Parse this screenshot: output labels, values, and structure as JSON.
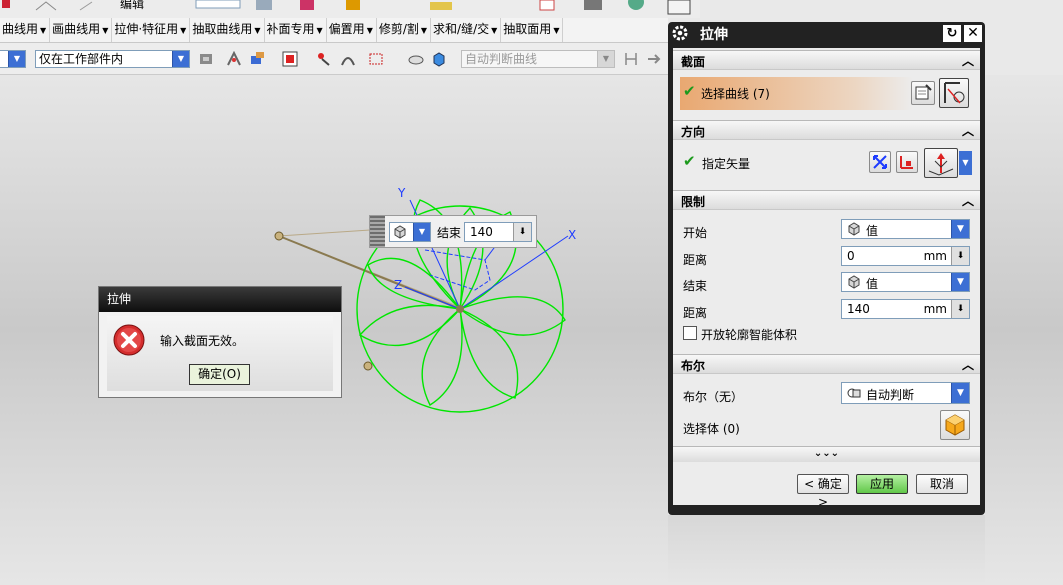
{
  "menubar": {
    "items": [
      "曲线用",
      "画曲线用",
      "拉伸·特征用",
      "抽取曲线用",
      "补面专用",
      "偏置用",
      "修剪/割",
      "求和/缝/交",
      "抽取面用"
    ]
  },
  "toolbar": {
    "edit_label": "编辑",
    "scope_filter": "仅在工作部件内",
    "curve_rule": "自动判断曲线"
  },
  "handle_widget": {
    "label": "结束",
    "value": "140"
  },
  "viewport": {
    "axis_x": "X",
    "axis_y": "Y",
    "axis_z": "Z",
    "curve_color": "#00e600"
  },
  "error_dialog": {
    "title": "拉伸",
    "message": "输入截面无效。",
    "ok_label": "确定(O)"
  },
  "extrude_dialog": {
    "title": "拉伸",
    "section": {
      "header": "截面",
      "select_curve": "选择曲线 (7)"
    },
    "direction": {
      "header": "方向",
      "specify_vector": "指定矢量"
    },
    "limits": {
      "header": "限制",
      "start_label": "开始",
      "start_option": "值",
      "start_distance_label": "距离",
      "start_distance": "0",
      "end_label": "结束",
      "end_option": "值",
      "end_distance_label": "距离",
      "end_distance": "140",
      "unit": "mm",
      "open_profile": "开放轮廓智能体积"
    },
    "boolean": {
      "header": "布尔",
      "boolean_label": "布尔（无）",
      "boolean_option": "自动判断",
      "select_body": "选择体 (0)"
    },
    "buttons": {
      "ok": "< 确定 >",
      "apply": "应用",
      "cancel": "取消"
    },
    "colors": {
      "selection_highlight": "#e9a871",
      "check": "#1c9a1c",
      "apply_button": "#7fd86a"
    }
  }
}
